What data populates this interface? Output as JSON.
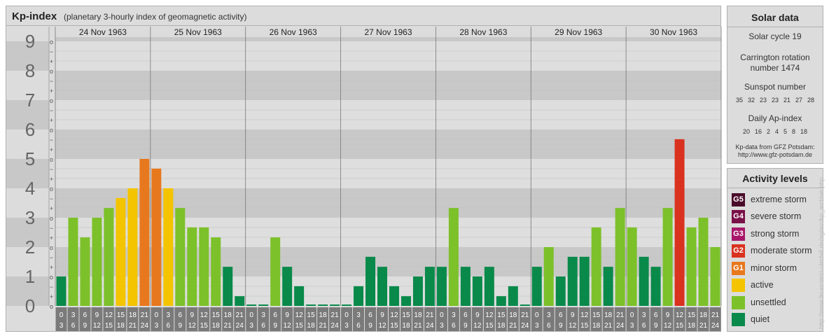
{
  "header": {
    "title": "Kp-index",
    "subtitle": "(planetary 3-hourly index of geomagnetic activity)"
  },
  "solar": {
    "title": "Solar data",
    "cycle": "Solar cycle 19",
    "carrington_line1": "Carrington rotation",
    "carrington_line2": "number 1474",
    "sunspot_label": "Sunspot number",
    "sunspot_values": [
      "35",
      "32",
      "23",
      "23",
      "21",
      "27",
      "28"
    ],
    "ap_label": "Daily Ap-index",
    "ap_values": [
      "20",
      "16",
      "2",
      "4",
      "5",
      "8",
      "18"
    ],
    "credit_line1": "Kp-data from GFZ Potsdam:",
    "credit_line2": "http://www.gfz-potsdam.de"
  },
  "legend": {
    "title": "Activity levels",
    "items": [
      {
        "code": "G5",
        "label": "extreme storm",
        "color": "#4a0a2a"
      },
      {
        "code": "G4",
        "label": "severe storm",
        "color": "#7a1048"
      },
      {
        "code": "G3",
        "label": "strong storm",
        "color": "#a8176a"
      },
      {
        "code": "G2",
        "label": "moderate storm",
        "color": "#d9321e"
      },
      {
        "code": "G1",
        "label": "minor storm",
        "color": "#e8781e"
      },
      {
        "code": "",
        "label": "active",
        "color": "#f5c400"
      },
      {
        "code": "",
        "label": "unsettled",
        "color": "#7cc02a"
      },
      {
        "code": "",
        "label": "quiet",
        "color": "#0a8a4a"
      }
    ]
  },
  "watermark": "http://www.feuerstein-ulerfall.de/ag/arc/kp_archive.php",
  "chart_data": {
    "type": "bar",
    "y_labels": [
      "0",
      "1",
      "2",
      "3",
      "4",
      "5",
      "6",
      "7",
      "8",
      "9"
    ],
    "ylim": [
      0,
      9.33
    ],
    "sub_marks": [
      "o",
      "+",
      "−"
    ],
    "days": [
      "24 Nov 1963",
      "25 Nov 1963",
      "26 Nov 1963",
      "27 Nov 1963",
      "28 Nov 1963",
      "29 Nov 1963",
      "30 Nov 1963"
    ],
    "interval_top": [
      "0",
      "3",
      "6",
      "9",
      "12",
      "15",
      "18",
      "21"
    ],
    "interval_bottom": [
      "3",
      "6",
      "9",
      "12",
      "15",
      "18",
      "21",
      "24"
    ],
    "values": [
      [
        1.0,
        3.0,
        2.33,
        3.0,
        3.33,
        3.67,
        4.0,
        5.0
      ],
      [
        4.67,
        4.0,
        3.33,
        2.67,
        2.67,
        2.33,
        1.33,
        0.33
      ],
      [
        0.0,
        0.0,
        2.33,
        1.33,
        0.67,
        0.0,
        0.0,
        0.0
      ],
      [
        0.0,
        0.67,
        1.67,
        1.33,
        0.67,
        0.33,
        1.0,
        1.33
      ],
      [
        1.33,
        3.33,
        1.33,
        1.0,
        1.33,
        0.33,
        0.67,
        0.0
      ],
      [
        1.33,
        2.0,
        1.0,
        1.67,
        1.67,
        2.67,
        1.33,
        3.33
      ],
      [
        2.67,
        1.67,
        1.33,
        3.33,
        5.67,
        2.67,
        3.0,
        2.0
      ]
    ],
    "colors": {
      "quiet": "#0a8a4a",
      "unsettled": "#7cc02a",
      "active": "#f5c400",
      "minor": "#e8781e",
      "moderate": "#d9321e"
    }
  }
}
